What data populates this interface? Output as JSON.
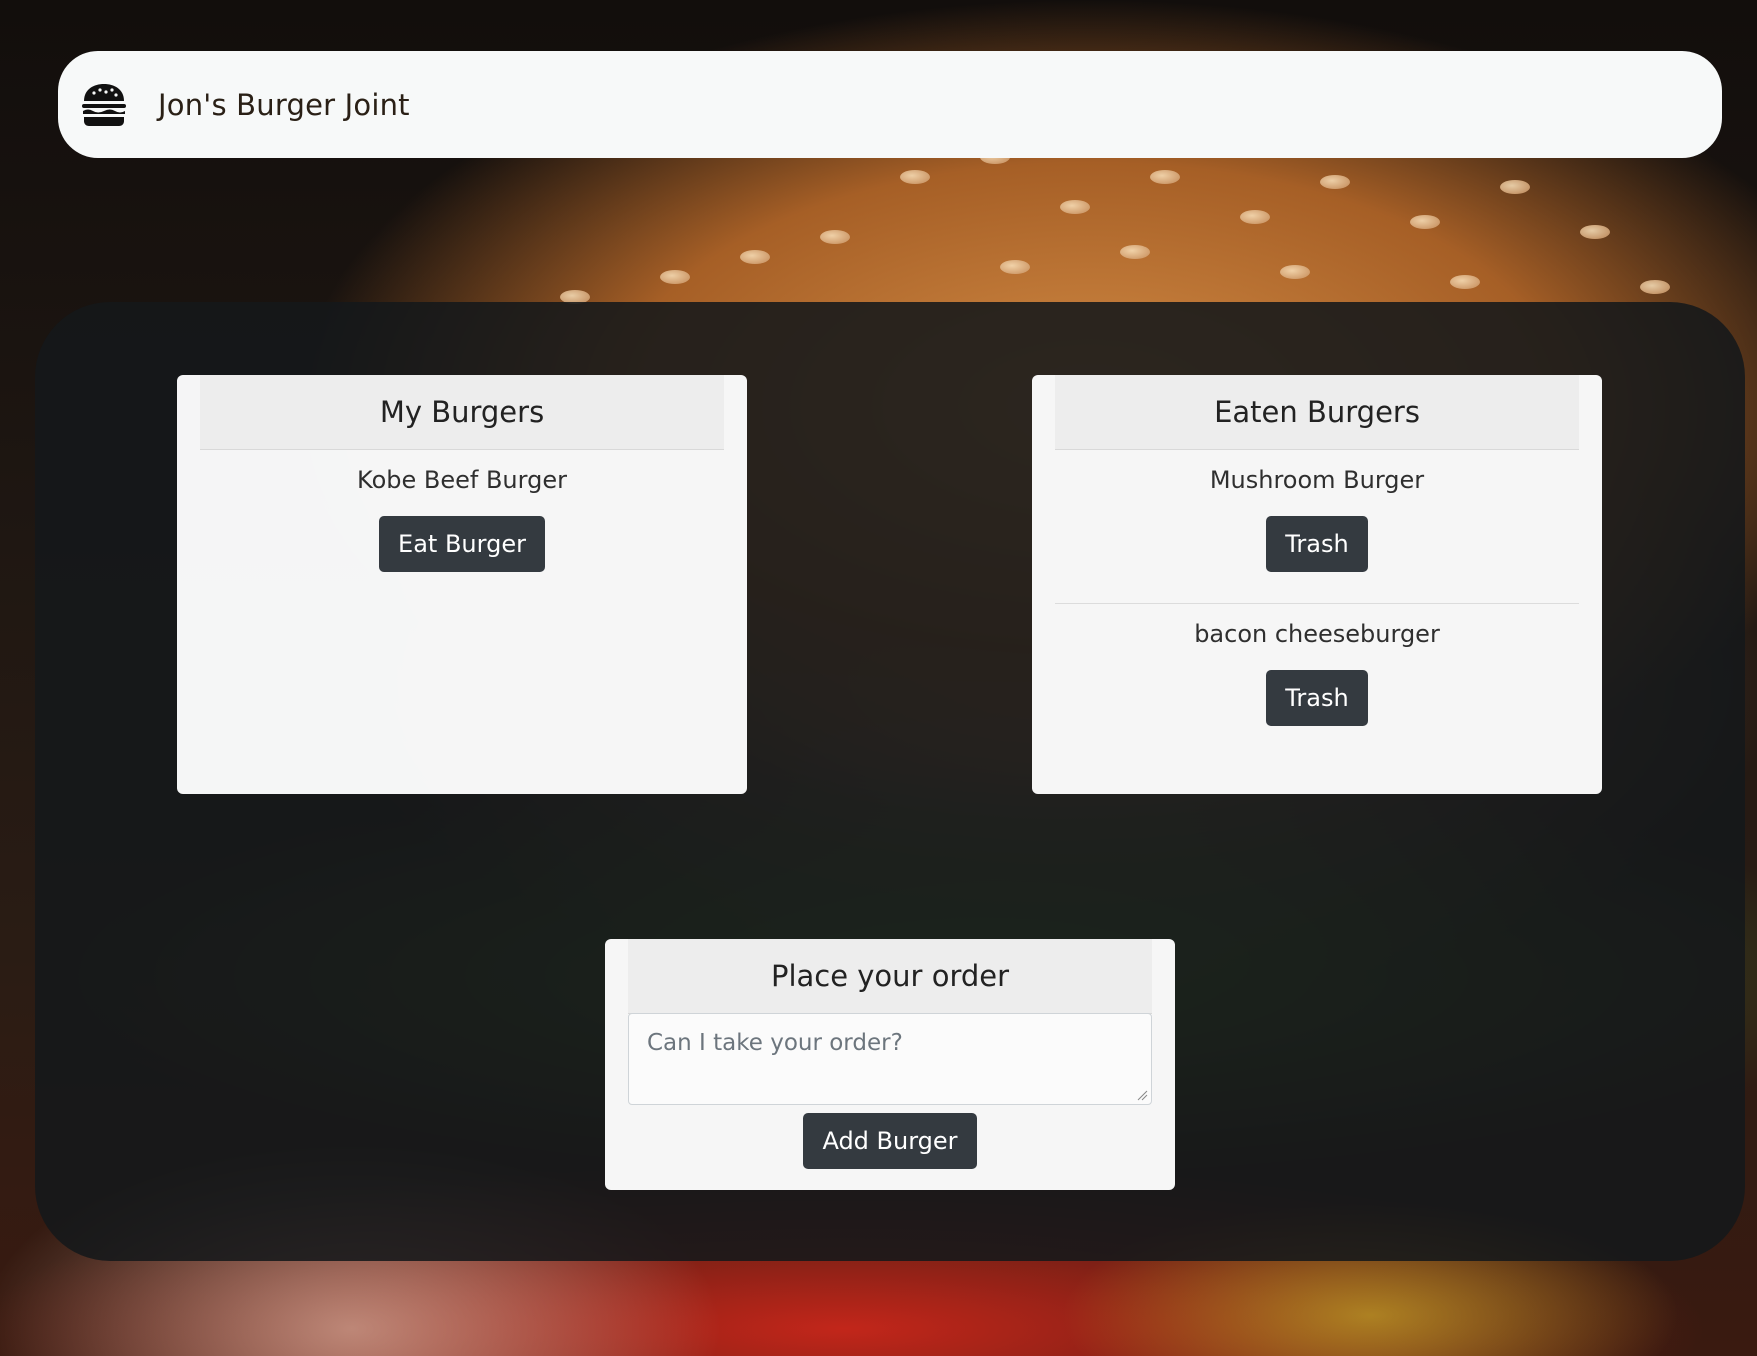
{
  "navbar": {
    "brand_icon": "hamburger-icon",
    "brand_text": "Jon's Burger Joint"
  },
  "my_burgers": {
    "title": "My Burgers",
    "items": [
      {
        "name": "Kobe Beef Burger",
        "button_label": "Eat Burger"
      }
    ]
  },
  "eaten_burgers": {
    "title": "Eaten Burgers",
    "items": [
      {
        "name": "Mushroom Burger",
        "button_label": "Trash"
      },
      {
        "name": "bacon cheeseburger",
        "button_label": "Trash"
      }
    ]
  },
  "order": {
    "title": "Place your order",
    "placeholder": "Can I take your order?",
    "value": "",
    "button_label": "Add Burger"
  },
  "colors": {
    "button_bg": "#343a40",
    "navbar_bg": "#f7f9f9",
    "panel_bg": "rgba(20,24,26,0.88)"
  }
}
